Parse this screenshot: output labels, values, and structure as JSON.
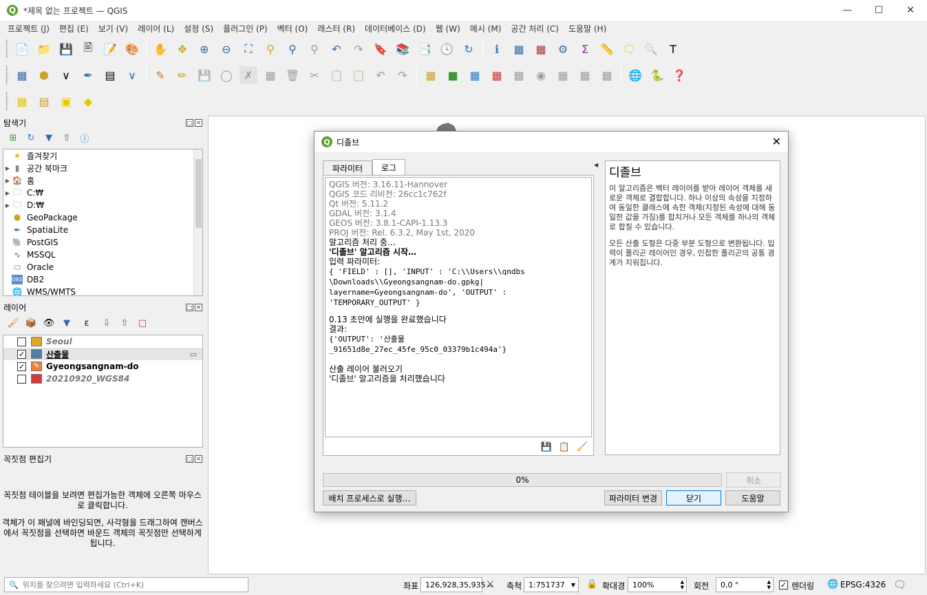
{
  "window": {
    "title": "*제목 없는 프로젝트 — QGIS",
    "logo": "Q"
  },
  "menu": [
    "프로젝트 (J)",
    "편집 (E)",
    "보기 (V)",
    "레이어 (L)",
    "설정 (S)",
    "플러그인 (P)",
    "벡터 (O)",
    "래스터 (R)",
    "데이터베이스 (D)",
    "웹 (W)",
    "메시 (M)",
    "공간 처리 (C)",
    "도움말 (H)"
  ],
  "browser": {
    "title": "탐색기",
    "items": [
      {
        "label": "즐겨찾기",
        "icon": "star-icon"
      },
      {
        "label": "공간 북마크",
        "icon": "bookmark-icon"
      },
      {
        "label": "홈",
        "icon": "home-folder-icon"
      },
      {
        "label": "C:₩",
        "icon": "drive-icon"
      },
      {
        "label": "D:₩",
        "icon": "drive-icon"
      },
      {
        "label": "GeoPackage",
        "icon": "geopackage-icon"
      },
      {
        "label": "SpatiaLite",
        "icon": "spatialite-icon"
      },
      {
        "label": "PostGIS",
        "icon": "postgis-icon"
      },
      {
        "label": "MSSQL",
        "icon": "mssql-icon"
      },
      {
        "label": "Oracle",
        "icon": "oracle-icon"
      },
      {
        "label": "DB2",
        "icon": "db2-icon"
      },
      {
        "label": "WMS/WMTS",
        "icon": "wms-icon"
      }
    ]
  },
  "layers": {
    "title": "레이어",
    "items": [
      {
        "label": "Seoul",
        "color": "#e0a62c"
      },
      {
        "label": "산출물",
        "color": "#4f7fa8"
      },
      {
        "label": "Gyeongsangnam-do",
        "color": "#e8833a"
      },
      {
        "label": "20210920_WGS84",
        "color": "#d23c3c"
      }
    ]
  },
  "vertex_editor": {
    "title": "꼭짓점 편집기",
    "text1": "꼭짓점 테이블을 보려면 편집가능한 객체에 오른쪽 마우스로 클릭합니다.",
    "text2": "객체가 이 패널에 바인딩되면, 사각형을 드래그하여 캔버스에서 꼭짓점을 선택하면 바운드 객체의 꼭짓점만 선택하게 됩니다."
  },
  "status": {
    "search_placeholder": "위치를 찾으려면 입력하세요 (Ctrl+K)",
    "coord_label": "좌표",
    "coord_value": "126,928,35,935",
    "scale_label": "축척",
    "scale_value": "1:751737",
    "magnify_label": "확대경",
    "magnify_value": "100%",
    "rotation_label": "회전",
    "rotation_value": "0,0 °",
    "render_label": "렌더링",
    "crs": "EPSG:4326"
  },
  "dialog": {
    "title": "디졸브",
    "tabs": [
      "파라미터",
      "로그"
    ],
    "log": {
      "version_lines": [
        "QGIS 버전: 3.16.11-Hannover",
        "QGIS 코드 리비전: 26cc1c762f",
        "Qt 버전: 5.11.2",
        "GDAL 버전: 3.1.4",
        "GEOS 버전: 3.8.1-CAPI-1.13.3",
        "PROJ 버전: Rel. 6.3.2, May 1st, 2020"
      ],
      "processing": "알고리즘 처리 중…",
      "start": "'디졸브' 알고리즘 시작…",
      "input_params": "입력 파라미터:",
      "params_code": [
        "{ 'FIELD' : [], 'INPUT' : 'C:\\\\Users\\\\qndbs",
        "\\Downloads\\\\Gyeongsangnam-do.gpkg|",
        "layername=Gyeongsangnam-do', 'OUTPUT' :",
        "'TEMPORARY_OUTPUT' }"
      ],
      "done": "0.13 초만에 실행을 완료했습니다",
      "result_label": "결과:",
      "result_code": [
        "{'OUTPUT': '산출물",
        "_91651d8e_27ec_45fe_95c0_03379b1c494a'}"
      ],
      "load": "산출 레이어 불러오기",
      "finished": "'디졸브' 알고리즘을 처리했습니다"
    },
    "help_title": "디졸브",
    "help_p1": "이 알고리즘은 벡터 레이어를 받아 레이어 객체를 새로운 객체로 결합합니다. 하나 이상의 속성을 지정하여 동일한 클래스에 속한 객체(지정된 속성에 대해 동일한 값을 가짐)를 합치거나 모든 객체를 하나의 객체로 합칠 수 있습니다.",
    "help_p2": "모든 산출 도형은 다중 부분 도형으로 변환됩니다. 입력이 폴리곤 레이어인 경우, 인접한 폴리곤의 공통 경계가 지워집니다.",
    "progress": "0%",
    "progress_value": 0,
    "buttons": {
      "cancel": "취소",
      "batch": "배치 프로세스로 실행…",
      "change_params": "파라미터 변경",
      "close": "닫기",
      "help": "도움말"
    }
  }
}
